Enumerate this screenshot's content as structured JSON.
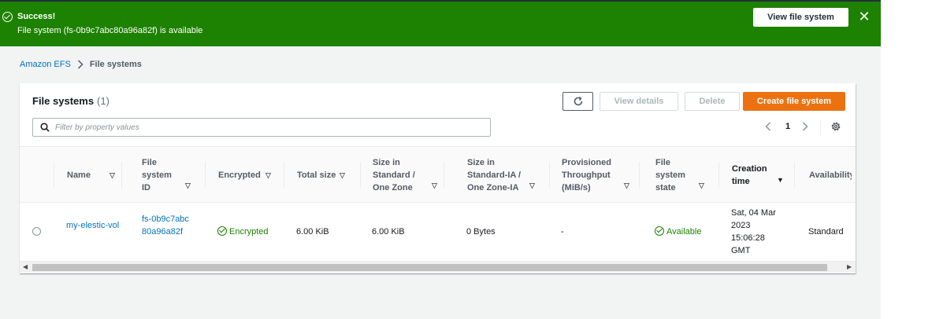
{
  "flash": {
    "title": "Success!",
    "message": "File system (fs-0b9c7abc80a96a82f) is available",
    "action_label": "View file system",
    "close_icon": "close-icon"
  },
  "breadcrumb": {
    "root": "Amazon EFS",
    "current": "File systems"
  },
  "panel": {
    "title": "File systems",
    "count": "(1)",
    "refresh_icon": "refresh-icon",
    "view_details": "View details",
    "delete": "Delete",
    "create": "Create file system"
  },
  "filter": {
    "placeholder": "Filter by property values"
  },
  "pagination": {
    "current_page": "1"
  },
  "table": {
    "columns": [
      {
        "label": "Name"
      },
      {
        "label": "File system ID"
      },
      {
        "label": "Encrypted"
      },
      {
        "label": "Total size"
      },
      {
        "label": "Size in Standard / One Zone"
      },
      {
        "label": "Size in Standard-IA / One Zone-IA"
      },
      {
        "label": "Provisioned Throughput (MiB/s)"
      },
      {
        "label": "File system state"
      },
      {
        "label": "Creation time"
      },
      {
        "label": "Availability Zone"
      }
    ],
    "rows": [
      {
        "name": "my-elestic-vol",
        "id": "fs-0b9c7abc80a96a82f",
        "encrypted": "Encrypted",
        "total_size": "6.00 KiB",
        "size_standard": "6.00 KiB",
        "size_ia": "0 Bytes",
        "throughput": "-",
        "state": "Available",
        "creation_time": "Sat, 04 Mar 2023 15:06:28 GMT",
        "availability_zone": "Standard"
      }
    ]
  },
  "colors": {
    "success": "#1d8102",
    "primary": "#ec7211",
    "link": "#0073bb"
  }
}
